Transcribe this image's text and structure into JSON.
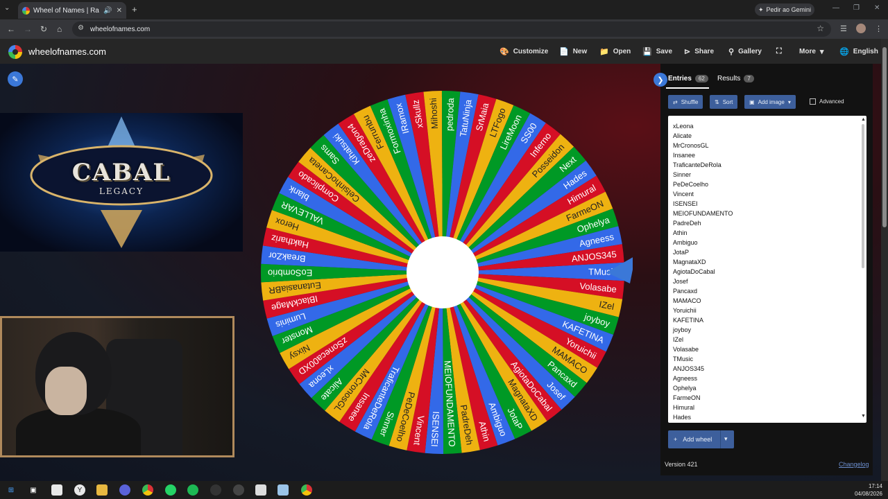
{
  "browser": {
    "tab_title": "Wheel of Names | Random",
    "url": "wheelofnames.com",
    "gemini_label": "Pedir ao Gemini"
  },
  "app": {
    "logo_text": "wheelofnames.com",
    "menu": {
      "customize": "Customize",
      "new": "New",
      "open": "Open",
      "save": "Save",
      "share": "Share",
      "gallery": "Gallery",
      "more": "More",
      "language": "English"
    }
  },
  "media": {
    "logo_title": "CABAL",
    "logo_subtitle": "LEGACY"
  },
  "wheel": {
    "colors": [
      "#3369e8",
      "#d50f25",
      "#eeb211",
      "#009925"
    ],
    "pointer_color": "#3b78d8",
    "segments": [
      "TMusic",
      "Volasabe",
      "IZel",
      "joyboy",
      "KAFETINA",
      "Yoruichii",
      "MAMACO",
      "Pancaxd",
      "Josef",
      "AgiotaDoCabal",
      "MagnataXD",
      "JotaP",
      "Ambiguo",
      "Athin",
      "PadreDeh",
      "MEIOFUNDAMENTO",
      "ISENSEI",
      "Vincent",
      "PeDeCoelho",
      "Sinner",
      "TraficanteDeRola",
      "Insanee",
      "MrCronosGL",
      "Alicate",
      "xLeona",
      "zSoneca00XD",
      "Nixsy",
      "Monster",
      "Luminis",
      "IBlackMage",
      "EutanasiaBR",
      "EoSombrio",
      "BreakZor",
      "Hakthariz",
      "Herox",
      "VALLEVAR",
      "blank",
      "Complicado",
      "CelsinhoCaneta",
      "Sams",
      "Kihatsuki",
      "zeDragon4",
      "Ferrunbu",
      "Formoxinha",
      "IRamox",
      "xSkullz",
      "Mihoshi",
      "pedroda",
      "TatuNinja",
      "SrMaia",
      "LTFogo",
      "LireMoon",
      "SS00",
      "Inferno",
      "Posseidon",
      "Next",
      "Hades",
      "Himural",
      "FarmeON",
      "Ophelya",
      "Agneess",
      "ANJOS345"
    ]
  },
  "panel": {
    "entries_label": "Entries",
    "entries_count": "62",
    "results_label": "Results",
    "results_count": "7",
    "shuffle_label": "Shuffle",
    "sort_label": "Sort",
    "add_image_label": "Add image",
    "advanced_label": "Advanced",
    "entries": [
      "xLeona",
      "Alicate",
      "MrCronosGL",
      "Insanee",
      "TraficanteDeRola",
      "Sinner",
      "PeDeCoelho",
      "Vincent",
      "ISENSEI",
      "MEIOFUNDAMENTO",
      "PadreDeh",
      "Athin",
      "Ambiguo",
      "JotaP",
      "MagnataXD",
      "AgiotaDoCabal",
      "Josef",
      "Pancaxd",
      "MAMACO",
      "Yoruichii",
      "KAFETINA",
      "joyboy",
      "IZel",
      "Volasabe",
      "TMusic",
      "ANJOS345",
      "Agneess",
      "Ophelya",
      "FarmeON",
      "Himural",
      "Hades"
    ],
    "add_wheel_label": "Add wheel",
    "version": "Version 421",
    "changelog": "Changelog"
  },
  "taskbar": {
    "time": "17:14",
    "date": "04/08/2026"
  }
}
